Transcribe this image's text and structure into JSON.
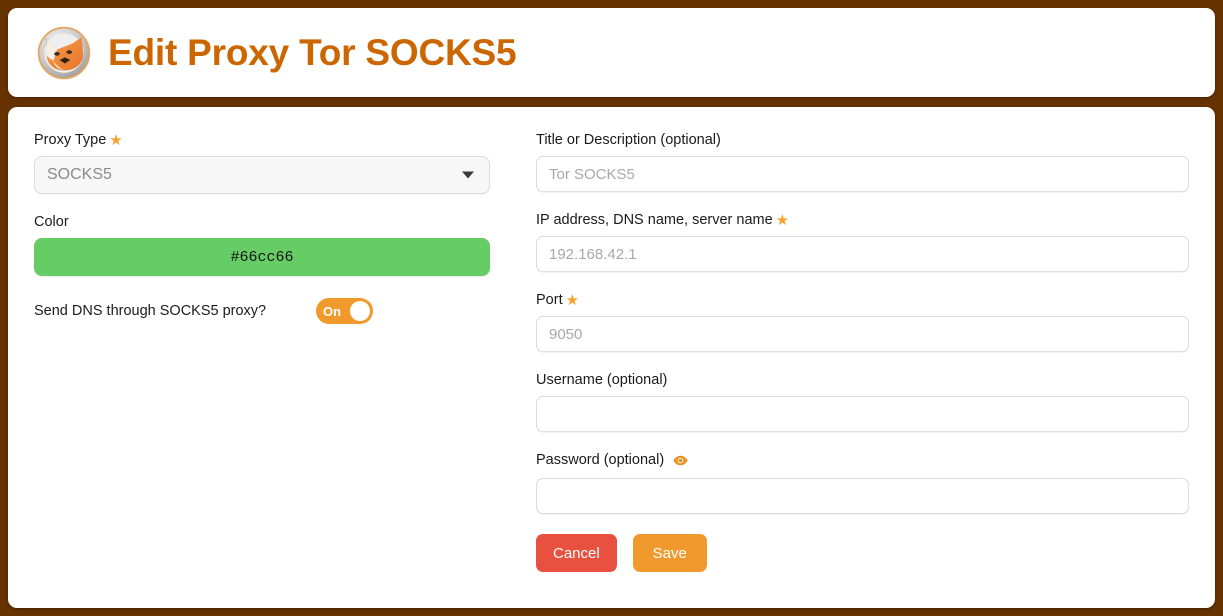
{
  "header": {
    "title": "Edit Proxy Tor SOCKS5",
    "logo_name": "foxyproxy-fox-logo",
    "title_color": "#cc6600"
  },
  "theme": {
    "page_background": "#663300",
    "card_background": "#ffffff",
    "accent_orange": "#f0992c",
    "cancel_red": "#e8513f",
    "star_color": "#f5a22b"
  },
  "left": {
    "proxy_type": {
      "label": "Proxy Type",
      "required_marker": "★",
      "value": "SOCKS5",
      "options": [
        "SOCKS5"
      ]
    },
    "color": {
      "label": "Color",
      "value": "#66cc66",
      "swatch_hex": "#66cc66"
    },
    "dns_toggle": {
      "label": "Send DNS through SOCKS5 proxy?",
      "state_text": "On",
      "checked": true
    }
  },
  "right": {
    "title_description": {
      "label": "Title or Description (optional)",
      "value": "",
      "placeholder": "Tor SOCKS5"
    },
    "host": {
      "label": "IP address, DNS name, server name",
      "required_marker": "★",
      "value": "",
      "placeholder": "192.168.42.1"
    },
    "port": {
      "label": "Port",
      "required_marker": "★",
      "value": "",
      "placeholder": "9050"
    },
    "username": {
      "label": "Username (optional)",
      "value": "",
      "placeholder": ""
    },
    "password": {
      "label": "Password (optional)",
      "value": "",
      "placeholder": "",
      "reveal_icon_name": "eye-icon"
    },
    "buttons": {
      "cancel": "Cancel",
      "save": "Save"
    }
  }
}
